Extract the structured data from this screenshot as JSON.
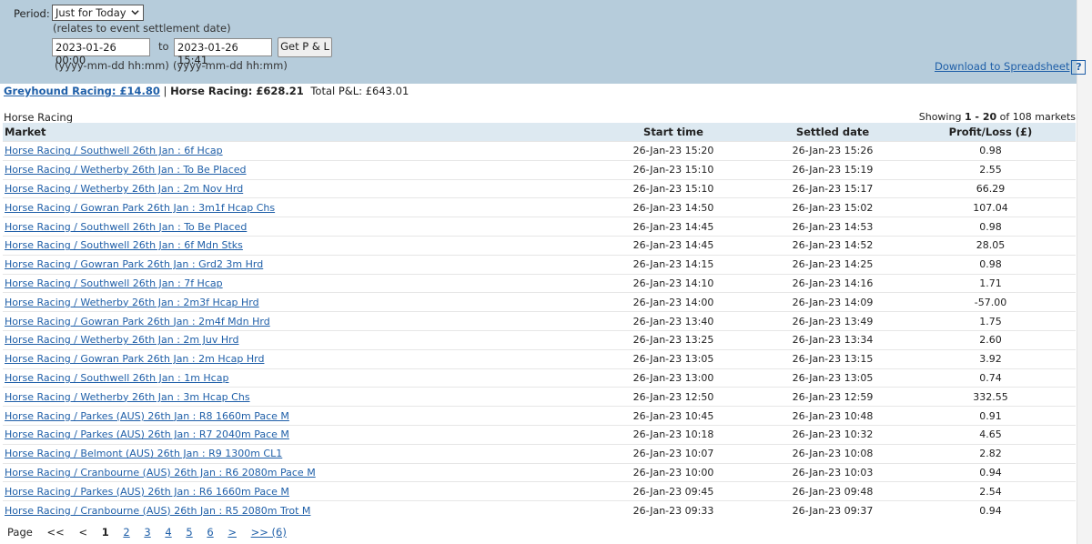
{
  "filter": {
    "period_label": "Period:",
    "period_value": "Just for Today",
    "period_note": "(relates to event settlement date)",
    "from_value": "2023-01-26 00:00",
    "to_label": "to",
    "to_value": "2023-01-26 15:41",
    "get_button": "Get P & L",
    "from_hint": "(yyyy-mm-dd hh:mm)",
    "to_hint": "(yyyy-mm-dd hh:mm)",
    "download_link": "Download to Spreadsheet",
    "help_label": "?"
  },
  "summary": {
    "greyhound": "Greyhound Racing: £14.80",
    "separator": "|",
    "horse": "Horse Racing: £628.21",
    "total": "Total P&L: £643.01"
  },
  "section": {
    "title": "Horse Racing",
    "showing_prefix": "Showing",
    "showing_range": "1 - 20",
    "showing_suffix": "of 108 markets"
  },
  "table": {
    "headers": {
      "market": "Market",
      "start": "Start time",
      "settled": "Settled date",
      "pl": "Profit/Loss (£)"
    },
    "rows": [
      {
        "market": "Horse Racing / Southwell 26th Jan : 6f Hcap",
        "start": "26-Jan-23 15:20",
        "settled": "26-Jan-23 15:26",
        "pl": "0.98"
      },
      {
        "market": "Horse Racing / Wetherby 26th Jan : To Be Placed",
        "start": "26-Jan-23 15:10",
        "settled": "26-Jan-23 15:19",
        "pl": "2.55"
      },
      {
        "market": "Horse Racing / Wetherby 26th Jan : 2m Nov Hrd",
        "start": "26-Jan-23 15:10",
        "settled": "26-Jan-23 15:17",
        "pl": "66.29"
      },
      {
        "market": "Horse Racing / Gowran Park 26th Jan : 3m1f Hcap Chs",
        "start": "26-Jan-23 14:50",
        "settled": "26-Jan-23 15:02",
        "pl": "107.04"
      },
      {
        "market": "Horse Racing / Southwell 26th Jan : To Be Placed",
        "start": "26-Jan-23 14:45",
        "settled": "26-Jan-23 14:53",
        "pl": "0.98"
      },
      {
        "market": "Horse Racing / Southwell 26th Jan : 6f Mdn Stks",
        "start": "26-Jan-23 14:45",
        "settled": "26-Jan-23 14:52",
        "pl": "28.05"
      },
      {
        "market": "Horse Racing / Gowran Park 26th Jan : Grd2 3m Hrd",
        "start": "26-Jan-23 14:15",
        "settled": "26-Jan-23 14:25",
        "pl": "0.98"
      },
      {
        "market": "Horse Racing / Southwell 26th Jan : 7f Hcap",
        "start": "26-Jan-23 14:10",
        "settled": "26-Jan-23 14:16",
        "pl": "1.71"
      },
      {
        "market": "Horse Racing / Wetherby 26th Jan : 2m3f Hcap Hrd",
        "start": "26-Jan-23 14:00",
        "settled": "26-Jan-23 14:09",
        "pl": "-57.00"
      },
      {
        "market": "Horse Racing / Gowran Park 26th Jan : 2m4f Mdn Hrd",
        "start": "26-Jan-23 13:40",
        "settled": "26-Jan-23 13:49",
        "pl": "1.75"
      },
      {
        "market": "Horse Racing / Wetherby 26th Jan : 2m Juv Hrd",
        "start": "26-Jan-23 13:25",
        "settled": "26-Jan-23 13:34",
        "pl": "2.60"
      },
      {
        "market": "Horse Racing / Gowran Park 26th Jan : 2m Hcap Hrd",
        "start": "26-Jan-23 13:05",
        "settled": "26-Jan-23 13:15",
        "pl": "3.92"
      },
      {
        "market": "Horse Racing / Southwell 26th Jan : 1m Hcap",
        "start": "26-Jan-23 13:00",
        "settled": "26-Jan-23 13:05",
        "pl": "0.74"
      },
      {
        "market": "Horse Racing / Wetherby 26th Jan : 3m Hcap Chs",
        "start": "26-Jan-23 12:50",
        "settled": "26-Jan-23 12:59",
        "pl": "332.55"
      },
      {
        "market": "Horse Racing / Parkes (AUS) 26th Jan : R8 1660m Pace M",
        "start": "26-Jan-23 10:45",
        "settled": "26-Jan-23 10:48",
        "pl": "0.91"
      },
      {
        "market": "Horse Racing / Parkes (AUS) 26th Jan : R7 2040m Pace M",
        "start": "26-Jan-23 10:18",
        "settled": "26-Jan-23 10:32",
        "pl": "4.65"
      },
      {
        "market": "Horse Racing / Belmont (AUS) 26th Jan : R9 1300m CL1",
        "start": "26-Jan-23 10:07",
        "settled": "26-Jan-23 10:08",
        "pl": "2.82"
      },
      {
        "market": "Horse Racing / Cranbourne (AUS) 26th Jan : R6 2080m Pace M",
        "start": "26-Jan-23 10:00",
        "settled": "26-Jan-23 10:03",
        "pl": "0.94"
      },
      {
        "market": "Horse Racing / Parkes (AUS) 26th Jan : R6 1660m Pace M",
        "start": "26-Jan-23 09:45",
        "settled": "26-Jan-23 09:48",
        "pl": "2.54"
      },
      {
        "market": "Horse Racing / Cranbourne (AUS) 26th Jan : R5 2080m Trot M",
        "start": "26-Jan-23 09:33",
        "settled": "26-Jan-23 09:37",
        "pl": "0.94"
      }
    ]
  },
  "pager": {
    "label": "Page",
    "first": "<<",
    "prev": "<",
    "current": "1",
    "pages": [
      "2",
      "3",
      "4",
      "5",
      "6"
    ],
    "next": ">",
    "last": ">> (6)"
  }
}
